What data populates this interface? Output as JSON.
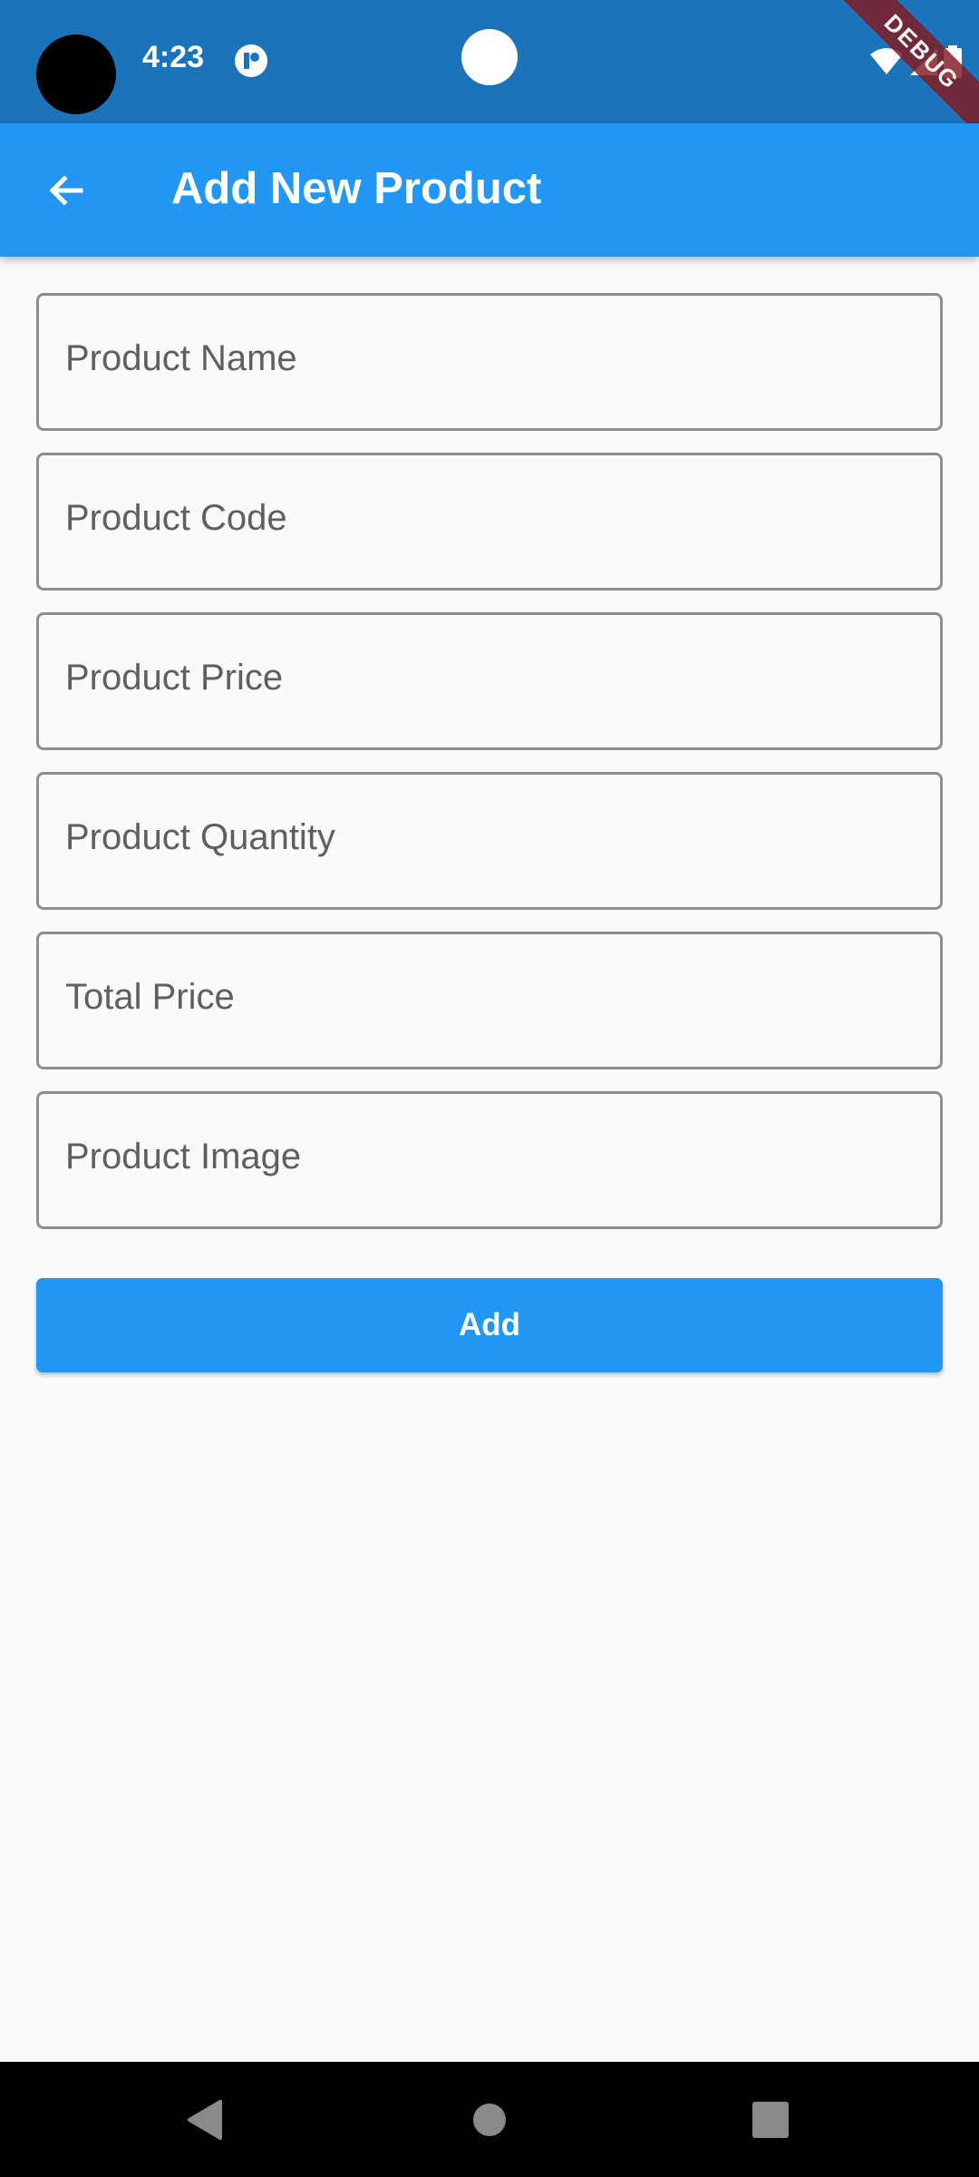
{
  "status_bar": {
    "time": "4:23",
    "icons": [
      "camera-cutout",
      "app-notification-icon",
      "wifi-icon",
      "signal-icon",
      "battery-icon"
    ],
    "debug_label": "DEBUG"
  },
  "app_bar": {
    "title": "Add New Product",
    "back_icon": "arrow-back-icon"
  },
  "form": {
    "fields": [
      {
        "placeholder": "Product Name",
        "value": ""
      },
      {
        "placeholder": "Product Code",
        "value": ""
      },
      {
        "placeholder": "Product Price",
        "value": ""
      },
      {
        "placeholder": "Product Quantity",
        "value": ""
      },
      {
        "placeholder": "Total Price",
        "value": ""
      },
      {
        "placeholder": "Product Image",
        "value": ""
      }
    ],
    "submit_label": "Add"
  },
  "nav_bar": {
    "icons": [
      "back-triangle-icon",
      "home-circle-icon",
      "recents-square-icon"
    ]
  },
  "colors": {
    "status_bar": "#1b74b9",
    "primary": "#2196f3",
    "background": "#fafafa",
    "field_border": "#8e8e8e",
    "placeholder": "#5f5f5f"
  }
}
